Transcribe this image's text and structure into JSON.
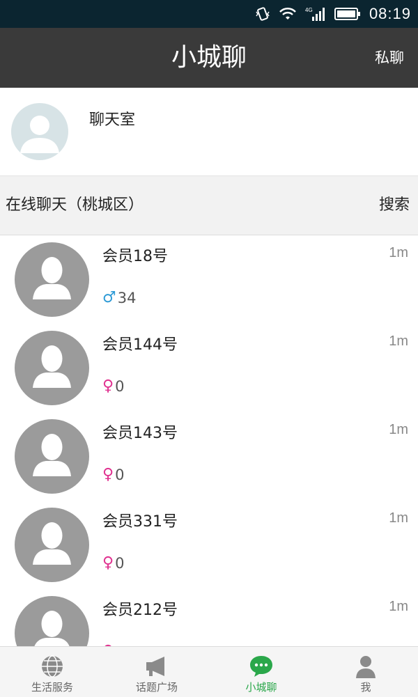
{
  "status_bar": {
    "time": "08:19",
    "network": "4G"
  },
  "header": {
    "title": "小城聊",
    "right_action": "私聊"
  },
  "chatroom": {
    "label": "聊天室"
  },
  "section": {
    "title": "在线聊天（桃城区）",
    "search_label": "搜索"
  },
  "members": [
    {
      "name": "会员18号",
      "time": "1m",
      "gender_icon": "male-icon",
      "gender_symbol": "♂",
      "value": "34"
    },
    {
      "name": "会员144号",
      "time": "1m",
      "gender_icon": "female-icon",
      "gender_symbol": "♀",
      "value": "0"
    },
    {
      "name": "会员143号",
      "time": "1m",
      "gender_icon": "female-icon",
      "gender_symbol": "♀",
      "value": "0"
    },
    {
      "name": "会员331号",
      "time": "1m",
      "gender_icon": "female-icon",
      "gender_symbol": "♀",
      "value": "0"
    },
    {
      "name": "会员212号",
      "time": "1m",
      "gender_icon": "female-icon",
      "gender_symbol": "♀",
      "value": ""
    }
  ],
  "nav": {
    "tabs": [
      {
        "label": "生活服务",
        "icon": "globe-icon"
      },
      {
        "label": "话题广场",
        "icon": "megaphone-icon"
      },
      {
        "label": "小城聊",
        "icon": "chat-bubble-icon"
      },
      {
        "label": "我",
        "icon": "person-icon"
      }
    ],
    "active_index": 2
  },
  "colors": {
    "status_bar": "#0b2530",
    "header": "#3a3a3a",
    "accent_green": "#2aa74a",
    "male": "#2f9bd6",
    "female": "#e0308f"
  }
}
